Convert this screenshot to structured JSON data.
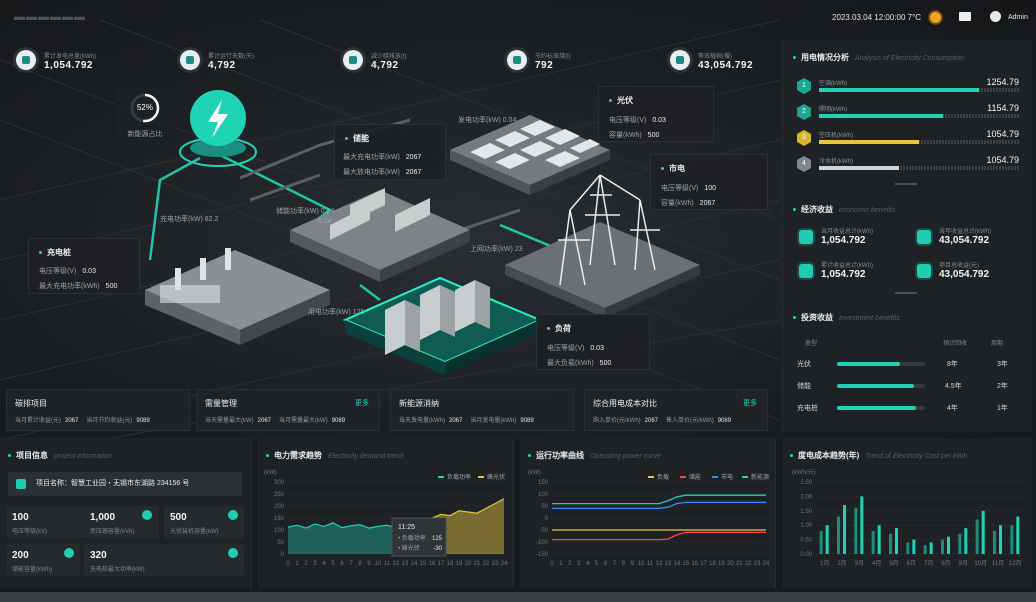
{
  "header": {
    "logo": "▬▬▬▬▬▬",
    "datetime": "2023.03.04  12:00:00  7°C",
    "user": "Admin"
  },
  "kpis": [
    {
      "label": "累计发电总量(kWh)",
      "value": "1,054.792"
    },
    {
      "label": "累计运行天数(天)",
      "value": "4,792"
    },
    {
      "label": "减少碳排放(t)",
      "value": "4,792"
    },
    {
      "label": "节约标准煤(t)",
      "value": "792"
    },
    {
      "label": "等效植树(棵)",
      "value": "43,054.792"
    }
  ],
  "gauge": {
    "percent": "52%",
    "label": "新能源占比",
    "value": 0.52
  },
  "scene": {
    "charge_label": "充电功率(kW) 82.2",
    "storage_small": "储能功率(kW) 0.04",
    "storage_small2": "0.04",
    "grid_label": "上网功率(kW) 23",
    "solar_label": "发电功率(kW) 0.04",
    "load_label": "用电功率(kW) 125"
  },
  "info_boxes": {
    "charging": {
      "title": "充电桩",
      "rows": [
        {
          "k": "电压等级(V)",
          "v": "0.03"
        },
        {
          "k": "最大充电功率(kWh)",
          "v": "500"
        }
      ]
    },
    "storage": {
      "title": "储能",
      "rows": [
        {
          "k": "最大充电功率(kW)",
          "v": "2067"
        },
        {
          "k": "最大放电功率(kW)",
          "v": "2067"
        }
      ]
    },
    "solar": {
      "title": "光伏",
      "rows": [
        {
          "k": "电压等级(V)",
          "v": "0.03"
        },
        {
          "k": "容量(kWh)",
          "v": "500"
        }
      ]
    },
    "grid": {
      "title": "市电",
      "rows": [
        {
          "k": "电压等级(V)",
          "v": "100"
        },
        {
          "k": "容量(kWh)",
          "v": "2067"
        }
      ]
    },
    "load": {
      "title": "负荷",
      "rows": [
        {
          "k": "电压等级(V)",
          "v": "0.03"
        },
        {
          "k": "最大负载(kWh)",
          "v": "500"
        }
      ]
    }
  },
  "mid_cards": [
    {
      "title": "碳排项目",
      "more": "",
      "rows": [
        {
          "k": "当月累计收益(元)",
          "v": "2067"
        },
        {
          "k": "当月节约收益(元)",
          "v": "9089"
        }
      ]
    },
    {
      "title": "需量管理",
      "more": "更多",
      "rows": [
        {
          "k": "当天需量最大(kW)",
          "v": "2067"
        },
        {
          "k": "当月需量最大(kW)",
          "v": "9089"
        }
      ]
    },
    {
      "title": "新能源消纳",
      "more": "",
      "rows": [
        {
          "k": "当天发电量(kWh)",
          "v": "2067"
        },
        {
          "k": "当月发电量(kWh)",
          "v": "9089"
        }
      ]
    },
    {
      "title": "综合用电成本对比",
      "more": "更多",
      "rows": [
        {
          "k": "购入单价(元/kWh)",
          "v": "2067"
        },
        {
          "k": "售入单价(元/kWh)",
          "v": "9089"
        }
      ]
    }
  ],
  "right": {
    "consumption": {
      "title": "用电情况分析",
      "en": "Analysis of Electricity Consumption",
      "items": [
        {
          "rank": "1",
          "name": "空调(kWh)",
          "value": "1254.79",
          "ratio": 0.8,
          "color": "#20d3b6"
        },
        {
          "rank": "2",
          "name": "照明(kWh)",
          "value": "1154.79",
          "ratio": 0.62,
          "color": "#20d3b6"
        },
        {
          "rank": "3",
          "name": "空压机(kWh)",
          "value": "1054.79",
          "ratio": 0.5,
          "color": "#e7c53c"
        },
        {
          "rank": "4",
          "name": "冷水机(kWh)",
          "value": "1054.79",
          "ratio": 0.4,
          "color": "#cfd6d8"
        }
      ]
    },
    "economic": {
      "title": "经济收益",
      "en": "economic benefits",
      "items": [
        {
          "label": "当月收益总计(kWh)",
          "value": "1,054.792"
        },
        {
          "label": "当年收益总计(kWh)",
          "value": "43,054.792"
        },
        {
          "label": "累计收益总计(kWh)",
          "value": "1,054.792"
        },
        {
          "label": "项目总收益(元)",
          "value": "43,054.792"
        }
      ]
    },
    "investment": {
      "title": "投资收益",
      "en": "Investment benefits",
      "headers": [
        "类型",
        "预计回收",
        "周期"
      ],
      "rows": [
        {
          "type": "光伏",
          "years": "8年",
          "cycle": "3年",
          "ratio": 0.72
        },
        {
          "type": "储能",
          "years": "4.5年",
          "cycle": "2年",
          "ratio": 0.88
        },
        {
          "type": "充电桩",
          "years": "4年",
          "cycle": "1年",
          "ratio": 0.9
        }
      ]
    }
  },
  "project": {
    "title": "项目信息",
    "en": "project information",
    "name": "项目名称：智慧工业园・无锡市东湖路 234156 号",
    "cells": [
      {
        "value": "100",
        "label": "电压等级(kV)"
      },
      {
        "value": "1,000",
        "label": "变压器容量(kVA)"
      },
      {
        "value": "500",
        "label": "光伏装机容量(kW)"
      },
      {
        "value": "200",
        "label": "储能容量(kWh)"
      },
      {
        "value": "320",
        "label": "充电桩最大功率(kW)"
      }
    ]
  },
  "chart_data": [
    {
      "type": "area",
      "title": "电力需求趋势",
      "en": "Electricity demand trend",
      "ylabel": "(kW)",
      "series": [
        {
          "name": "负载功率",
          "color": "#20d3b6"
        },
        {
          "name": "峰光伏",
          "color": "#e7c53c"
        }
      ],
      "ylim": [
        0,
        300
      ],
      "yticks": [
        "300",
        "250",
        "200",
        "150",
        "100",
        "50",
        "0"
      ],
      "xticks": [
        "0",
        "1",
        "2",
        "3",
        "4",
        "5",
        "6",
        "7",
        "8",
        "9",
        "10",
        "11",
        "12",
        "13",
        "14",
        "15",
        "16",
        "17",
        "18",
        "19",
        "20",
        "21",
        "22",
        "23",
        "24"
      ],
      "values_a": [
        112,
        120,
        108,
        125,
        115,
        130,
        110,
        118,
        122,
        108,
        115,
        120,
        110,
        118
      ],
      "values_b": [
        118,
        128,
        135,
        142,
        150,
        165,
        160,
        180,
        175,
        170,
        190,
        210,
        230
      ],
      "tooltip": {
        "time": "11:25",
        "rows": [
          {
            "k": "负载功率",
            "v": "125"
          },
          {
            "k": "峰光伏",
            "v": "-30"
          }
        ]
      }
    },
    {
      "type": "line",
      "title": "运行功率曲线",
      "en": "Operating power curve",
      "ylabel": "(kW)",
      "series": [
        {
          "name": "负载",
          "color": "#e7c53c",
          "values": [
            -50,
            -50,
            -50,
            -50,
            -50,
            -50,
            -50,
            -50,
            -50,
            -50,
            -50,
            -50,
            -50,
            -50,
            -50,
            -50,
            -50,
            -50,
            -50,
            -50,
            -50,
            -50,
            -50,
            -50,
            -50
          ]
        },
        {
          "name": "储能",
          "color": "#ff4455",
          "values": [
            -90,
            -90,
            -90,
            -90,
            -90,
            -90,
            -90,
            -90,
            -90,
            -90,
            -90,
            -90,
            -90,
            -88,
            -70,
            -60,
            -60,
            -60,
            -60,
            -60,
            -60,
            -60,
            -60,
            -60,
            -60
          ]
        },
        {
          "name": "市电",
          "color": "#3a8cff",
          "values": [
            40,
            40,
            40,
            40,
            40,
            40,
            40,
            40,
            40,
            40,
            40,
            40,
            40,
            45,
            60,
            65,
            65,
            65,
            65,
            65,
            65,
            65,
            65,
            65,
            65
          ]
        },
        {
          "name": "新能源",
          "color": "#20d3b6",
          "values": [
            60,
            60,
            60,
            60,
            60,
            60,
            60,
            60,
            60,
            60,
            60,
            60,
            60,
            72,
            88,
            95,
            95,
            95,
            95,
            95,
            95,
            95,
            95,
            95,
            95
          ]
        }
      ],
      "ylim": [
        -150,
        150
      ],
      "yticks": [
        "150",
        "100",
        "50",
        "0",
        "-50",
        "-100",
        "-150"
      ],
      "xticks": [
        "0",
        "1",
        "2",
        "3",
        "4",
        "5",
        "6",
        "7",
        "8",
        "9",
        "10",
        "11",
        "12",
        "13",
        "14",
        "15",
        "16",
        "17",
        "18",
        "19",
        "20",
        "21",
        "22",
        "23",
        "24"
      ]
    },
    {
      "type": "bar",
      "title": "度电成本趋势(年)",
      "en": "Trend of Electricity Cost per kWh",
      "ylabel": "(kWh/元)",
      "ylim": [
        0,
        2.5
      ],
      "yticks": [
        "2.50",
        "2.00",
        "1.50",
        "1.00",
        "0.50",
        "0.00"
      ],
      "categories": [
        "1月",
        "2月",
        "3月",
        "4月",
        "5月",
        "6月",
        "7月",
        "8月",
        "9月",
        "10月",
        "11月",
        "12月"
      ],
      "values": [
        1.0,
        1.7,
        2.0,
        1.0,
        0.9,
        0.5,
        0.4,
        0.6,
        0.9,
        1.5,
        1.0,
        1.3
      ],
      "values2": [
        0.8,
        1.3,
        1.6,
        0.8,
        0.7,
        0.4,
        0.3,
        0.5,
        0.7,
        1.2,
        0.8,
        1.0
      ]
    }
  ]
}
